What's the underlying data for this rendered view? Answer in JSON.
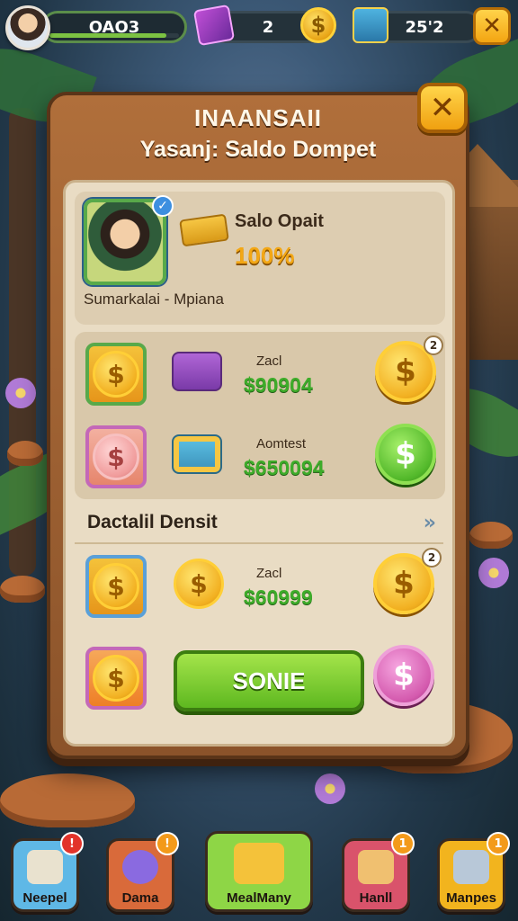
{
  "hud": {
    "xp_text": "OAO3",
    "xp_progress": 0.9,
    "gems_text": "2",
    "coins_text": "25'2",
    "coin_symbol": "$",
    "close_symbol": "✕"
  },
  "dialog": {
    "title": "INAANSAII",
    "subtitle": "Yasanj: Saldo Dompet",
    "close_symbol": "✕",
    "profile": {
      "badge": "✓",
      "label": "Salo Opait",
      "value": "100%",
      "name": "Sumarkalai - Mpiana"
    },
    "rows_top": [
      {
        "label": "Zacl",
        "amount": "$90904",
        "badge": "2",
        "action_variant": "gold",
        "slot_variant": "green",
        "item_variant": "purple"
      },
      {
        "label": "Aomtest",
        "amount": "$650094",
        "badge": "",
        "action_variant": "green",
        "slot_variant": "pink",
        "item_variant": "teal"
      }
    ],
    "section_title": "Dactalil Densit",
    "section_arrow": "»",
    "row_detail": {
      "label": "Zacl",
      "amount": "$60999",
      "badge": "2"
    },
    "confirm_label": "SONIE",
    "coin_symbol": "$"
  },
  "nav": [
    {
      "label": "Neepel",
      "badge": "!",
      "color": "#5fb8e6",
      "icon_color": "#e9e2cf",
      "badge_color": "red"
    },
    {
      "label": "Dama",
      "badge": "!",
      "color": "#d96a3a",
      "icon_color": "#8a6ae0",
      "badge_color": "orange"
    },
    {
      "label": "MealMany",
      "badge": "",
      "color": "#8ed646",
      "icon_color": "#f4c23a",
      "badge_color": ""
    },
    {
      "label": "Hanll",
      "badge": "1",
      "color": "#d9536b",
      "icon_color": "#f0c070",
      "badge_color": "orange"
    },
    {
      "label": "Manpes",
      "badge": "1",
      "color": "#f2b41e",
      "icon_color": "#b8c8d8",
      "badge_color": "orange"
    }
  ]
}
